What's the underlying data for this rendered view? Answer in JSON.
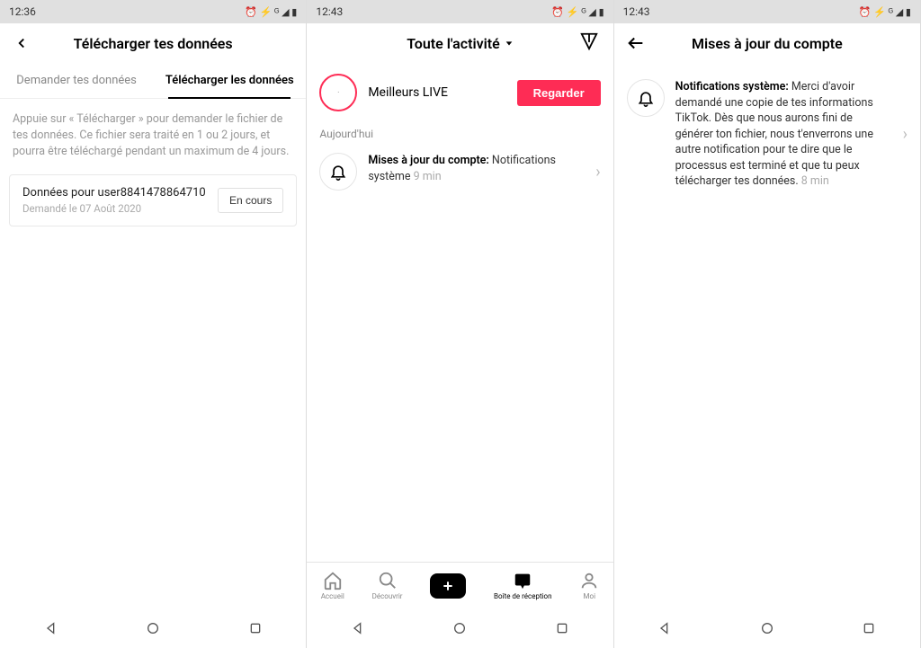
{
  "panel1": {
    "time": "12:36",
    "title": "Télécharger tes données",
    "tabs": {
      "request": "Demander tes données",
      "download": "Télécharger les données"
    },
    "description": "Appuie sur « Télécharger » pour demander le fichier de tes données. Ce fichier sera traité en 1 ou 2 jours, et pourra être téléchargé pendant un maximum de 4 jours.",
    "card": {
      "title": "Données pour user8841478864710",
      "subtitle": "Demandé le 07 Août 2020",
      "status": "En cours"
    }
  },
  "panel2": {
    "time": "12:43",
    "title": "Toute l'activité",
    "live": {
      "label": "Meilleurs LIVE",
      "button": "Regarder"
    },
    "section": "Aujourd'hui",
    "notif": {
      "bold": "Mises à jour du compte:",
      "text": " Notifications système",
      "time": " 9 min"
    },
    "tabbar": {
      "home": "Accueil",
      "discover": "Découvrir",
      "inbox": "Boîte de réception",
      "me": "Moi"
    }
  },
  "panel3": {
    "time": "12:43",
    "title": "Mises à jour du compte",
    "notif": {
      "bold": "Notifications système:",
      "text": " Merci d'avoir demandé une copie de tes informations TikTok. Dès que nous aurons fini de générer ton fichier, nous t'enverrons une autre notification pour te dire que le processus est terminé et que tu peux télécharger tes données.",
      "time": " 8 min"
    }
  },
  "status_icons": "⏰ ⚡ ᴳ ◢ ▮"
}
